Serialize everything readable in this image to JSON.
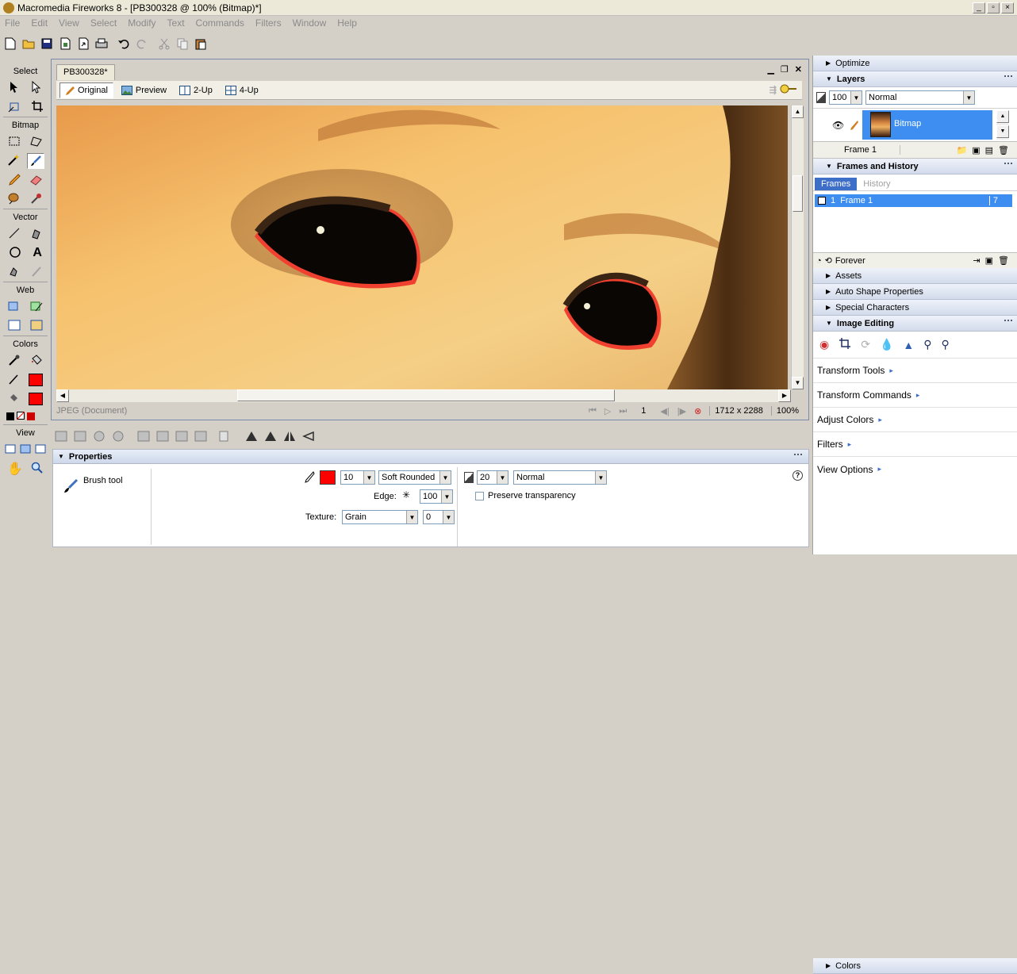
{
  "window": {
    "title": "Macromedia Fireworks 8 - [PB300328 @ 100% (Bitmap)*]",
    "controls": [
      "_",
      "▫",
      "×"
    ]
  },
  "menu": [
    "File",
    "Edit",
    "View",
    "Select",
    "Modify",
    "Text",
    "Commands",
    "Filters",
    "Window",
    "Help"
  ],
  "tools": {
    "sections": [
      "Select",
      "Bitmap",
      "Vector",
      "Web",
      "Colors",
      "View"
    ],
    "stroke_color": "#ff0000",
    "fill_color": "#ff0000"
  },
  "document": {
    "tab": "PB300328*",
    "views": [
      "Original",
      "Preview",
      "2-Up",
      "4-Up"
    ],
    "status_type": "JPEG (Document)",
    "frame": "1",
    "size": "1712 x 2288",
    "zoom": "100%"
  },
  "properties": {
    "title": "Properties",
    "tool_name": "Brush tool",
    "stroke_size": "10",
    "tip_shape": "Soft Rounded",
    "edge_label": "Edge:",
    "edge_value": "100",
    "texture_label": "Texture:",
    "texture": "Grain",
    "texture_amount": "0",
    "opacity": "20",
    "blend": "Normal",
    "preserve_label": "Preserve transparency",
    "stroke_color": "#ff0000"
  },
  "panels": {
    "optimize": "Optimize",
    "layers": {
      "title": "Layers",
      "opacity": "100",
      "blend": "Normal",
      "layer_name": "Bitmap",
      "frame_label": "Frame 1"
    },
    "frames_history": {
      "title": "Frames and History",
      "tabs": [
        "Frames",
        "History"
      ],
      "frame_number": "1",
      "frame_name": "Frame 1",
      "delay": "7",
      "loop": "Forever"
    },
    "collapsed": [
      "Assets",
      "Auto Shape Properties",
      "Special Characters"
    ],
    "image_editing": {
      "title": "Image Editing",
      "links": [
        "Transform Tools",
        "Transform Commands",
        "Adjust Colors",
        "Filters",
        "View Options"
      ]
    },
    "colors": "Colors"
  }
}
